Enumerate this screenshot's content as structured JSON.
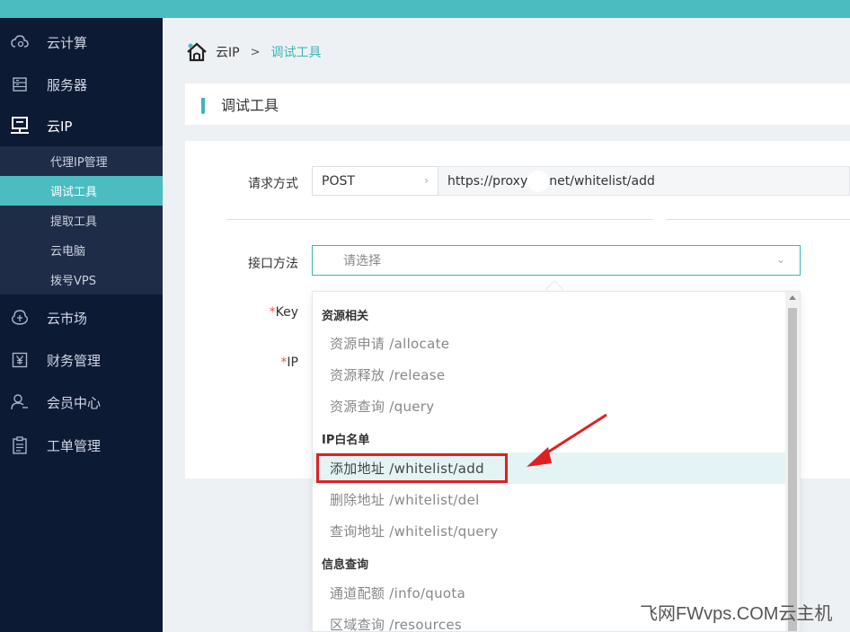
{
  "sidebar": {
    "items": [
      {
        "label": "云计算",
        "icon": "cloud-icon"
      },
      {
        "label": "服务器",
        "icon": "server-icon"
      },
      {
        "label": "云IP",
        "icon": "monitor-icon"
      },
      {
        "label": "云市场",
        "icon": "market-icon"
      },
      {
        "label": "财务管理",
        "icon": "yen-icon"
      },
      {
        "label": "会员中心",
        "icon": "user-icon"
      },
      {
        "label": "工单管理",
        "icon": "ticket-icon"
      }
    ],
    "submenu": [
      "代理IP管理",
      "调试工具",
      "提取工具",
      "云电脑",
      "拨号VPS"
    ]
  },
  "breadcrumb": {
    "root": "云IP",
    "sep": ">",
    "current": "调试工具"
  },
  "page_title": "调试工具",
  "form": {
    "request_method_label": "请求方式",
    "request_method_value": "POST",
    "url_part1": "https://proxy",
    "url_part2": "net/whitelist/add",
    "api_method_label": "接口方法",
    "api_method_placeholder": "请选择",
    "key_label": "Key",
    "ip_label": "IP",
    "required_mark": "*"
  },
  "dropdown": {
    "groups": [
      {
        "title": "资源相关",
        "options": [
          "资源申请 /allocate",
          "资源释放 /release",
          "资源查询 /query"
        ]
      },
      {
        "title": "IP白名单",
        "options": [
          "添加地址 /whitelist/add",
          "删除地址 /whitelist/del",
          "查询地址 /whitelist/query"
        ]
      },
      {
        "title": "信息查询",
        "options": [
          "通道配额 /info/quota",
          "区域查询 /resources"
        ]
      }
    ]
  },
  "watermark": "飞网FWvps.COM云主机",
  "colors": {
    "accent": "#4bbcbf",
    "sidebar_bg": "#0d1a34",
    "submenu_bg": "#1f2c47",
    "highlight": "#e02020"
  }
}
